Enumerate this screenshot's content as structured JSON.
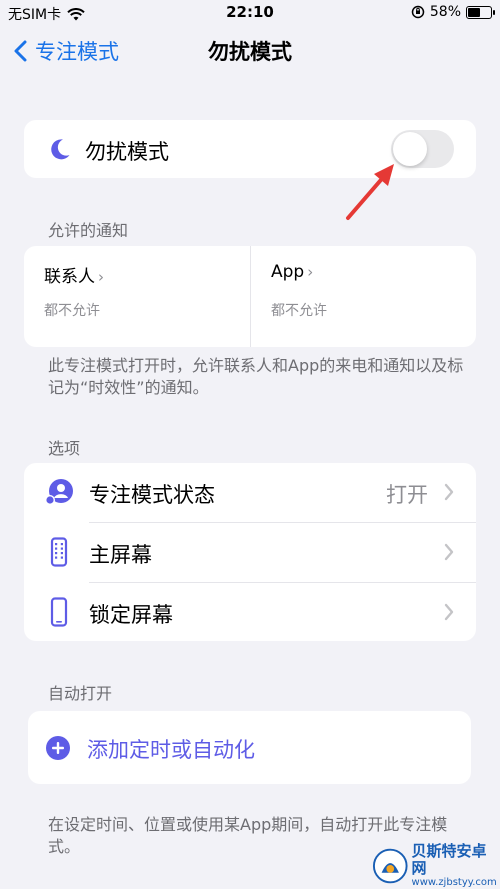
{
  "status_bar": {
    "carrier": "无SIM卡",
    "time": "22:10",
    "battery": "58%",
    "battery_level": 0.58
  },
  "nav": {
    "back_label": "专注模式",
    "title": "勿扰模式"
  },
  "dnd": {
    "label": "勿扰模式",
    "enabled": false
  },
  "allowed": {
    "header": "允许的通知",
    "people": {
      "title": "联系人",
      "subtitle": "都不允许"
    },
    "apps": {
      "title": "App",
      "subtitle": "都不允许"
    },
    "footnote": "此专注模式打开时，允许联系人和App的来电和通知以及标记为“时效性”的通知。"
  },
  "options": {
    "header": "选项",
    "items": [
      {
        "label": "专注模式状态",
        "value": "打开",
        "icon": "focus-status-icon"
      },
      {
        "label": "主屏幕",
        "value": "",
        "icon": "home-screen-icon"
      },
      {
        "label": "锁定屏幕",
        "value": "",
        "icon": "lock-screen-icon"
      }
    ]
  },
  "automation": {
    "header": "自动打开",
    "add_label": "添加定时或自动化",
    "footnote": "在设定时间、位置或使用某App期间，自动打开此专注模式。"
  },
  "watermark": {
    "name": "贝斯特安卓网",
    "url": "www.zjbstyy.com"
  },
  "colors": {
    "accent": "#5e5ce6",
    "link": "#1a73e8",
    "annotation_arrow": "#e53935"
  }
}
